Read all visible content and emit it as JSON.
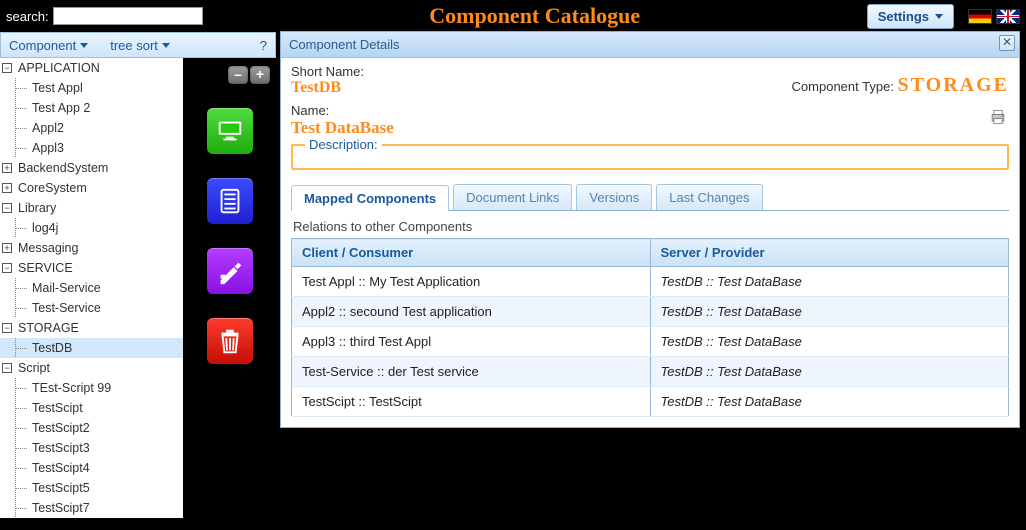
{
  "header": {
    "search_label": "search:",
    "search_placeholder": "",
    "title": "Component Catalogue",
    "settings_label": "Settings"
  },
  "tree_toolbar": {
    "component": "Component",
    "tree_sort": "tree sort",
    "help": "?"
  },
  "tree": [
    {
      "label": "APPLICATION",
      "open": true,
      "children": [
        {
          "label": "Test Appl"
        },
        {
          "label": "Test App 2"
        },
        {
          "label": "Appl2"
        },
        {
          "label": "Appl3"
        }
      ]
    },
    {
      "label": "BackendSystem",
      "open": false
    },
    {
      "label": "CoreSystem",
      "open": false
    },
    {
      "label": "Library",
      "open": true,
      "children": [
        {
          "label": "log4j"
        }
      ]
    },
    {
      "label": "Messaging",
      "open": false
    },
    {
      "label": "SERVICE",
      "open": true,
      "children": [
        {
          "label": "Mail-Service"
        },
        {
          "label": "Test-Service"
        }
      ]
    },
    {
      "label": "STORAGE",
      "open": true,
      "children": [
        {
          "label": "TestDB",
          "selected": true
        }
      ]
    },
    {
      "label": "Script",
      "open": true,
      "children": [
        {
          "label": "TEst-Script 99"
        },
        {
          "label": "TestScipt"
        },
        {
          "label": "TestScipt2"
        },
        {
          "label": "TestScipt3"
        },
        {
          "label": "TestScipt4"
        },
        {
          "label": "TestScipt5"
        },
        {
          "label": "TestScipt7"
        }
      ]
    }
  ],
  "details": {
    "panel_title": "Component Details",
    "short_name_label": "Short Name:",
    "short_name_value": "TestDB",
    "name_label": "Name:",
    "name_value": "Test DataBase",
    "component_type_label": "Component Type:",
    "component_type_value": "Storage",
    "description_label": "Description:",
    "tabs": [
      "Mapped Components",
      "Document Links",
      "Versions",
      "Last Changes"
    ],
    "relations_title": "Relations to other Components",
    "col_client": "Client / Consumer",
    "col_server": "Server / Provider",
    "rows": [
      {
        "client": "Test Appl :: My Test Application",
        "server": "TestDB :: Test DataBase"
      },
      {
        "client": "Appl2 :: secound Test application",
        "server": "TestDB :: Test DataBase"
      },
      {
        "client": "Appl3 :: third Test Appl",
        "server": "TestDB :: Test DataBase"
      },
      {
        "client": "Test-Service :: der Test service",
        "server": "TestDB :: Test DataBase"
      },
      {
        "client": "TestScipt :: TestScipt",
        "server": "TestDB :: Test DataBase"
      }
    ]
  }
}
